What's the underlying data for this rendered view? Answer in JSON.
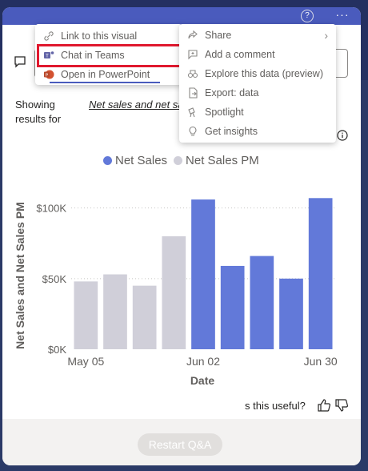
{
  "header": {
    "help_icon": "question-circle-icon",
    "more_icon": "ellipsis-icon"
  },
  "menu_left": {
    "items": [
      {
        "label": "Link to this visual",
        "icon": "link-icon"
      },
      {
        "label": "Chat in Teams",
        "icon": "teams-icon"
      },
      {
        "label": "Open in PowerPoint",
        "icon": "powerpoint-icon"
      }
    ]
  },
  "menu_right": {
    "items": [
      {
        "label": "Share",
        "icon": "share-icon"
      },
      {
        "label": "Add a comment",
        "icon": "comment-icon"
      },
      {
        "label": "Explore this data (preview)",
        "icon": "explore-icon"
      },
      {
        "label": "Export: data",
        "icon": "export-icon"
      },
      {
        "label": "Spotlight",
        "icon": "spotlight-icon"
      },
      {
        "label": "Get insights",
        "icon": "lightbulb-icon"
      }
    ]
  },
  "qa": {
    "showing_label": "Showing results for",
    "result_text": "Net sales and net sales stacked column chart"
  },
  "useful": {
    "label": "s this useful?"
  },
  "footer": {
    "restart_label": "Restart Q&A"
  },
  "colors": {
    "net_sales": "#6279d9",
    "net_sales_pm": "#d0cfd9",
    "highlight": "#e0182e"
  },
  "chart_data": {
    "type": "bar",
    "xlabel": "Date",
    "ylabel": "Net Sales and Net Sales PM",
    "ylim": [
      0,
      110000
    ],
    "yticks": [
      "$0K",
      "$50K",
      "$100K"
    ],
    "xticks": [
      "May 05",
      "Jun 02",
      "Jun 30"
    ],
    "legend": [
      "Net Sales",
      "Net Sales PM"
    ],
    "bars": [
      {
        "series": "Net Sales PM",
        "value": 48000
      },
      {
        "series": "Net Sales PM",
        "value": 53000
      },
      {
        "series": "Net Sales PM",
        "value": 45000
      },
      {
        "series": "Net Sales PM",
        "value": 80000
      },
      {
        "series": "Net Sales",
        "value": 106000
      },
      {
        "series": "Net Sales",
        "value": 59000
      },
      {
        "series": "Net Sales",
        "value": 66000
      },
      {
        "series": "Net Sales",
        "value": 50000
      },
      {
        "series": "Net Sales",
        "value": 107000
      }
    ]
  }
}
